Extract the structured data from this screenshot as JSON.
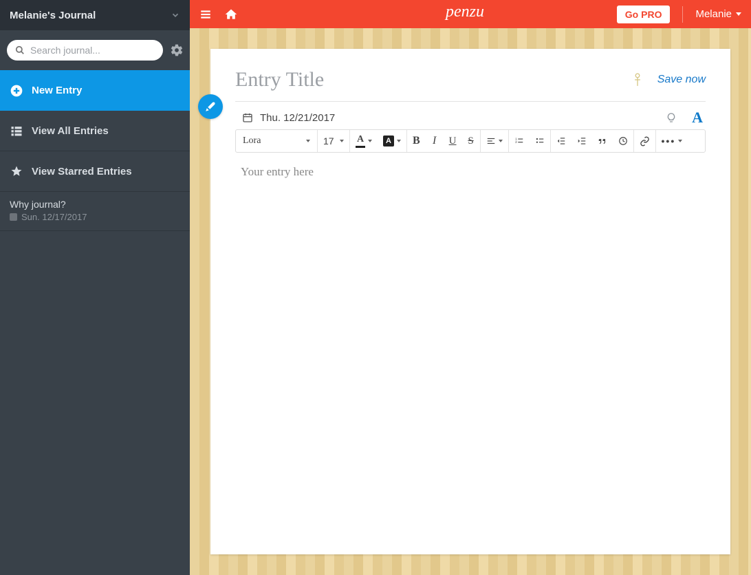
{
  "brand": "penzu",
  "header": {
    "go_pro": "Go PRO",
    "user_name": "Melanie"
  },
  "sidebar": {
    "journal_title": "Melanie's Journal",
    "search_placeholder": "Search journal...",
    "items": [
      {
        "label": "New Entry"
      },
      {
        "label": "View All Entries"
      },
      {
        "label": "View Starred Entries"
      }
    ],
    "entries": [
      {
        "title": "Why journal?",
        "date": "Sun. 12/17/2017"
      }
    ]
  },
  "editor": {
    "title_placeholder": "Entry Title",
    "save_now": "Save now",
    "date": "Thu. 12/21/2017",
    "body_placeholder": "Your entry here",
    "toolbar": {
      "font": "Lora",
      "size": "17"
    }
  }
}
